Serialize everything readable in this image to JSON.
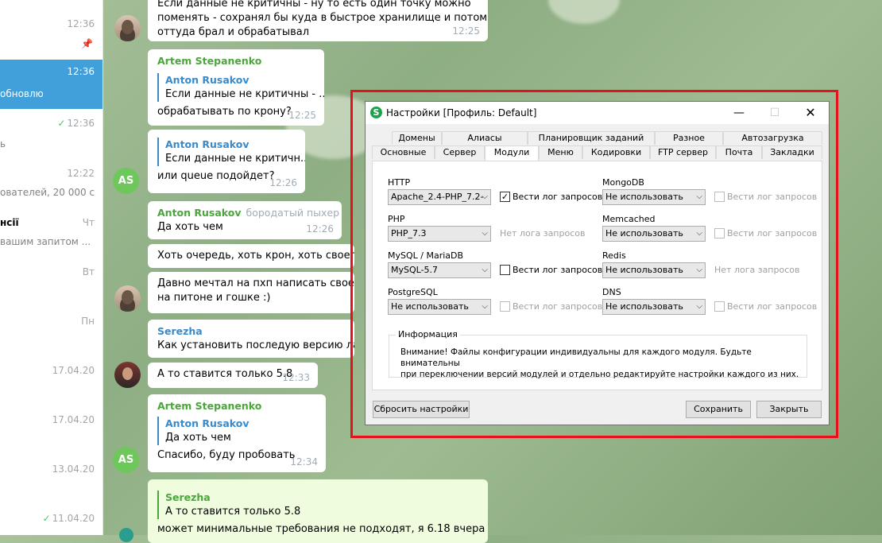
{
  "chatlist": [
    {
      "time": "12:36",
      "preview": "",
      "pinned": true,
      "active": false,
      "check": false
    },
    {
      "time": "12:36",
      "preview": "обновлю",
      "pinned": false,
      "active": true,
      "check": false
    },
    {
      "time": "12:36",
      "preview": "ь",
      "pinned": false,
      "active": false,
      "check": true
    },
    {
      "time": "12:22",
      "preview": "ователей, 20 000 с",
      "pinned": false,
      "active": false,
      "check": false
    },
    {
      "time": "Чт",
      "preview": "вашим запитом ...",
      "title": "нсії",
      "pinned": false,
      "active": false,
      "check": false
    },
    {
      "time": "Вт",
      "preview": "",
      "pinned": false,
      "active": false,
      "check": false
    },
    {
      "time": "Пн",
      "preview": "",
      "pinned": false,
      "active": false,
      "check": false
    },
    {
      "time": "17.04.20",
      "preview": "",
      "pinned": false,
      "active": false,
      "check": false
    },
    {
      "time": "17.04.20",
      "preview": "",
      "pinned": false,
      "active": false,
      "check": false
    },
    {
      "time": "13.04.20",
      "preview": "",
      "pinned": false,
      "active": false,
      "check": false
    },
    {
      "time": "11.04.20",
      "preview": "",
      "pinned": false,
      "active": false,
      "check": true
    }
  ],
  "messages": {
    "m1": {
      "line1": "Если данные не критичны - ну то есть один точку можно",
      "line2": "поменять - сохранял бы куда в быстрое хранилище и потом уже",
      "line3": "оттуда брал и обрабатывал",
      "time": "12:25"
    },
    "m2": {
      "sender": "Artem Stepanenko",
      "quote_name": "Anton Rusakov",
      "quote_text": "Если данные не критичны - ...",
      "text": "обрабатывать по крону?",
      "time": "12:25"
    },
    "m3": {
      "quote_name": "Anton Rusakov",
      "quote_text": "Если данные не критичн...",
      "text": "или queue подойдет?",
      "time": "12:26",
      "avatar": "AS"
    },
    "m4": {
      "sender": "Anton Rusakov",
      "rank": "бородатый пыхер",
      "text": "Да хоть чем",
      "time": "12:26"
    },
    "m5": {
      "text": "Хоть очередь, хоть крон, хоть своего дем"
    },
    "m6": {
      "line1": "Давно мечтал на пхп написать своего дем",
      "line2": "на питоне и гошке :)"
    },
    "m7": {
      "sender": "Serezha",
      "text": "Как установить последую версию лары на"
    },
    "m8": {
      "text": "А то ставится только 5.8",
      "time": "12:33"
    },
    "m9": {
      "sender": "Artem Stepanenko",
      "quote_name": "Anton Rusakov",
      "quote_text": "Да хоть чем",
      "text": "Спасибо, буду пробовать",
      "time": "12:34",
      "avatar": "AS"
    },
    "m10": {
      "quote_name": "Serezha",
      "quote_text": "А то ставится только 5.8",
      "text": "может минимальные требования не подходят, я 6.18 вчера"
    }
  },
  "dialog": {
    "title": "Настройки [Профиль: Default]",
    "icon_letter": "S",
    "tabs_row1": [
      "Домены",
      "Алиасы",
      "Планировщик заданий",
      "Разное",
      "Автозагрузка"
    ],
    "tabs_row2": [
      "Основные",
      "Сервер",
      "Модули",
      "Меню",
      "Кодировки",
      "FTP сервер",
      "Почта",
      "Закладки"
    ],
    "selected_tab": "Модули",
    "modules": {
      "http": {
        "label": "HTTP",
        "value": "Apache_2.4-PHP_7.2-",
        "log_label": "Вести лог запросов",
        "log_checked": true
      },
      "php": {
        "label": "PHP",
        "value": "PHP_7.3",
        "nolog": "Нет лога запросов"
      },
      "mysql": {
        "label": "MySQL / MariaDB",
        "value": "MySQL-5.7",
        "log_label": "Вести лог запросов",
        "log_checked": false
      },
      "postgres": {
        "label": "PostgreSQL",
        "value": "Не использовать",
        "log_label": "Вести лог запросов",
        "log_checked": false
      },
      "mongo": {
        "label": "MongoDB",
        "value": "Не использовать",
        "log_label": "Вести лог запросов",
        "log_checked": false
      },
      "memcached": {
        "label": "Memcached",
        "value": "Не использовать",
        "log_label": "Вести лог запросов",
        "log_checked": false
      },
      "redis": {
        "label": "Redis",
        "value": "Не использовать",
        "nolog": "Нет лога запросов"
      },
      "dns": {
        "label": "DNS",
        "value": "Не использовать",
        "log_label": "Вести лог запросов",
        "log_checked": false
      }
    },
    "info_title": "Информация",
    "info_line1": "Внимание! Файлы конфигурации индивидуальны для каждого модуля. Будьте внимательны",
    "info_line2": "при переключении версий модулей и отдельно редактируйте настройки каждого из них.",
    "btn_reset": "Сбросить настройки",
    "btn_save": "Сохранить",
    "btn_close": "Закрыть",
    "checkmark": "✓"
  }
}
